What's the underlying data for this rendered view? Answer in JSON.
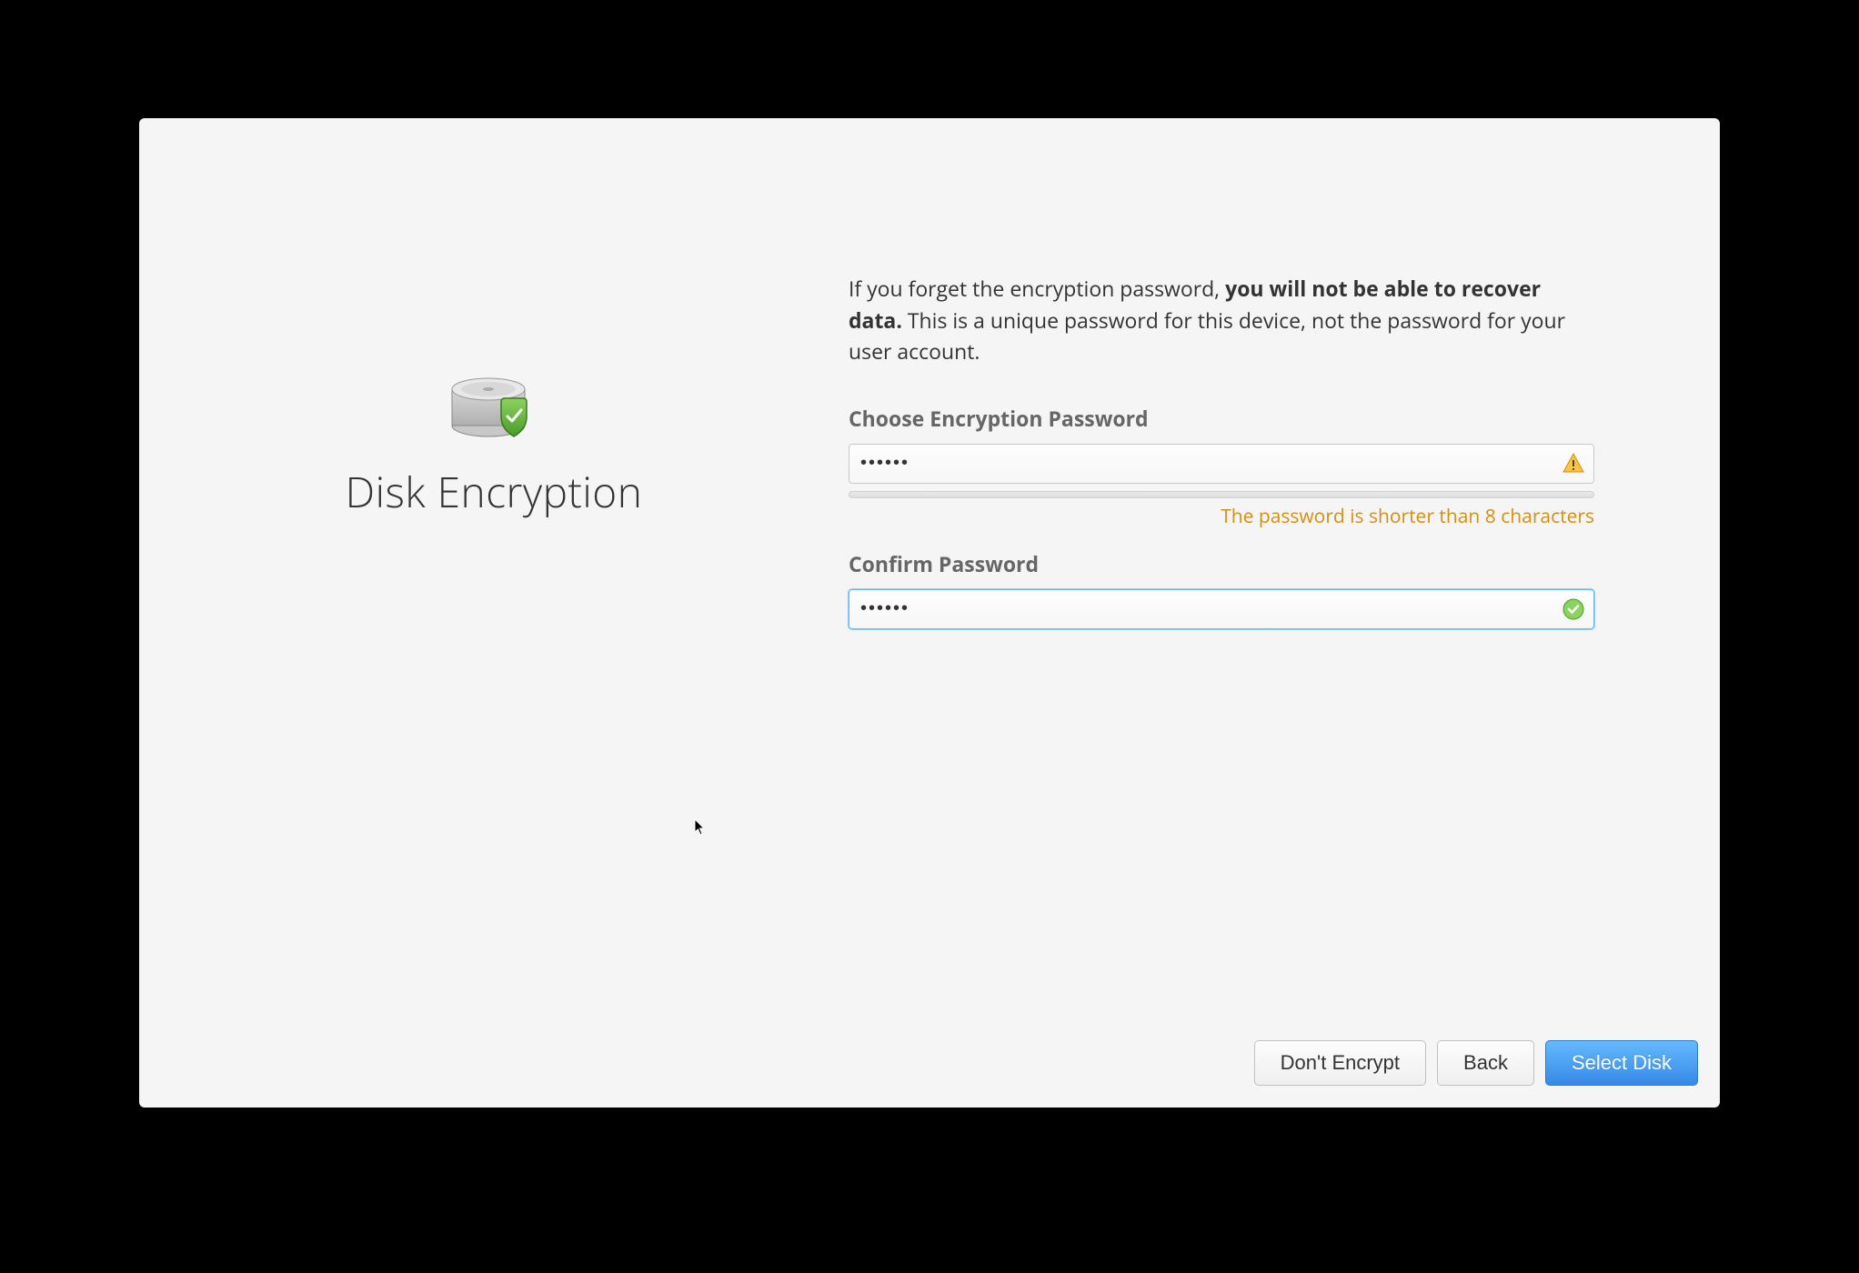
{
  "page": {
    "title": "Disk Encryption"
  },
  "info": {
    "prefix": "If you forget the encryption password, ",
    "bold": "you will not be able to recover data.",
    "suffix": " This is a unique password for this device, not the password for your user account."
  },
  "fields": {
    "choose": {
      "label": "Choose Encryption Password",
      "value": "••••••",
      "strength_message": "The password is shorter than 8 characters",
      "icon": "warning"
    },
    "confirm": {
      "label": "Confirm Password",
      "value": "••••••",
      "icon": "check"
    }
  },
  "buttons": {
    "dont_encrypt": "Don't Encrypt",
    "back": "Back",
    "select_disk": "Select Disk"
  },
  "colors": {
    "warning": "#d48e15",
    "accent": "#3689e6",
    "success": "#68b723"
  }
}
